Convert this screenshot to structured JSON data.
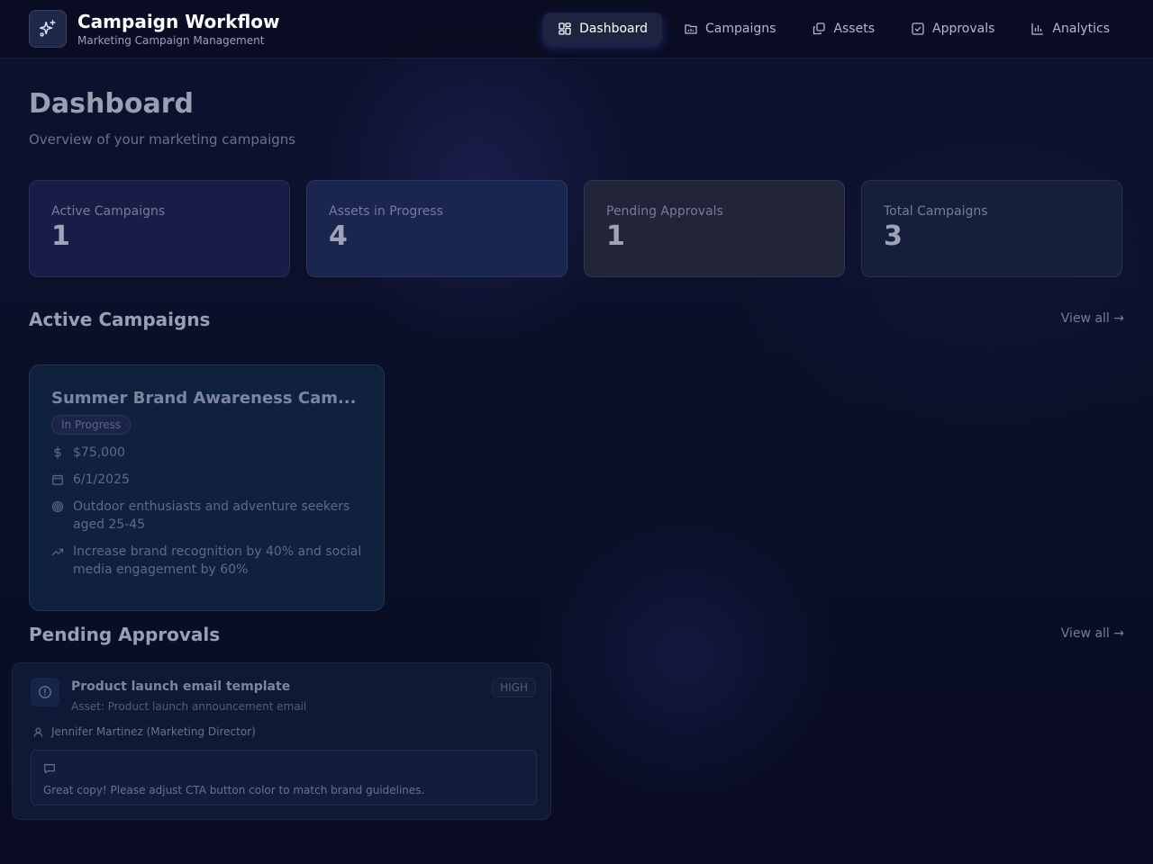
{
  "app": {
    "title": "Campaign Workflow",
    "subtitle": "Marketing Campaign Management",
    "logo_icon": "sparkles-icon"
  },
  "nav": {
    "items": [
      {
        "label": "Dashboard",
        "icon": "grid-icon",
        "active": true
      },
      {
        "label": "Campaigns",
        "icon": "folder-chart-icon",
        "active": false
      },
      {
        "label": "Assets",
        "icon": "copy-icon",
        "active": false
      },
      {
        "label": "Approvals",
        "icon": "checkbox-icon",
        "active": false
      },
      {
        "label": "Analytics",
        "icon": "bar-chart-icon",
        "active": false
      }
    ]
  },
  "page": {
    "title": "Dashboard",
    "subtitle": "Overview of your marketing campaigns"
  },
  "stats": [
    {
      "label": "Active Campaigns",
      "value": "1",
      "color": "#181d48"
    },
    {
      "label": "Assets in Progress",
      "value": "4",
      "color": "#1b2650"
    },
    {
      "label": "Pending Approvals",
      "value": "1",
      "color": "#22243a"
    },
    {
      "label": "Total Campaigns",
      "value": "3",
      "color": "#151f3c"
    }
  ],
  "active_campaigns": {
    "title": "Active Campaigns",
    "view_all": "View all →",
    "items": [
      {
        "title": "Summer Brand Awareness Cam...",
        "status": "In Progress",
        "budget": "$75,000",
        "date": "6/1/2025",
        "audience": "Outdoor enthusiasts and adventure seekers aged 25-45",
        "goal": "Increase brand recognition by 40% and social media engagement by 60%"
      }
    ]
  },
  "pending_approvals": {
    "title": "Pending Approvals",
    "view_all": "View all →",
    "items": [
      {
        "title": "Product launch email template",
        "asset": "Asset: Product launch announcement email",
        "priority": "HIGH",
        "reviewer": "Jennifer Martinez (Marketing Director)",
        "comment": "Great copy! Please adjust CTA button color to match brand guidelines."
      }
    ]
  }
}
